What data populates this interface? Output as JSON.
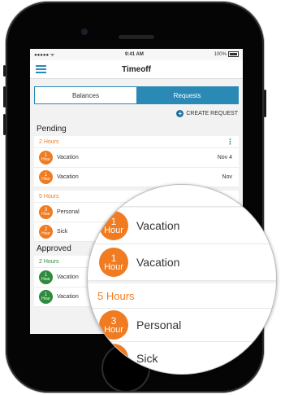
{
  "status": {
    "carrier": "●●●●● ᯤ",
    "time": "9:41 AM",
    "battery": "100%"
  },
  "nav": {
    "title": "Timeoff"
  },
  "tabs": [
    {
      "label": "Balances"
    },
    {
      "label": "Requests"
    }
  ],
  "create_label": "CREATE REQUEST",
  "pending": {
    "title": "Pending",
    "groups": [
      {
        "header": "2 Hours",
        "rows": [
          {
            "num": "1",
            "unit": "Hour",
            "label": "Vacation",
            "date": "Nov 4"
          },
          {
            "num": "1",
            "unit": "Hour",
            "label": "Vacation",
            "date": "Nov"
          }
        ]
      },
      {
        "header": "5 Hours",
        "rows": [
          {
            "num": "3",
            "unit": "Hour",
            "label": "Personal"
          },
          {
            "num": "2",
            "unit": "Hour",
            "label": "Sick"
          }
        ]
      }
    ]
  },
  "approved": {
    "title": "Approved",
    "groups": [
      {
        "header": "2 Hours",
        "rows": [
          {
            "num": "1",
            "unit": "Hour",
            "label": "Vacation"
          },
          {
            "num": "1",
            "unit": "Hour",
            "label": "Vacation"
          }
        ]
      }
    ]
  },
  "magnifier": {
    "top_header_fragment": "urs",
    "rows_top": [
      {
        "num": "1",
        "unit": "Hour",
        "label": "Vacation"
      },
      {
        "num": "1",
        "unit": "Hour",
        "label": "Vacation"
      }
    ],
    "group_header": "5 Hours",
    "rows_bottom": [
      {
        "num": "3",
        "unit": "Hour",
        "label": "Personal"
      },
      {
        "num": "2",
        "unit": "Hour",
        "label": "Sick"
      }
    ]
  },
  "colors": {
    "accent": "#2a8ab5",
    "orange": "#f07b20",
    "green": "#2e8b3c"
  }
}
